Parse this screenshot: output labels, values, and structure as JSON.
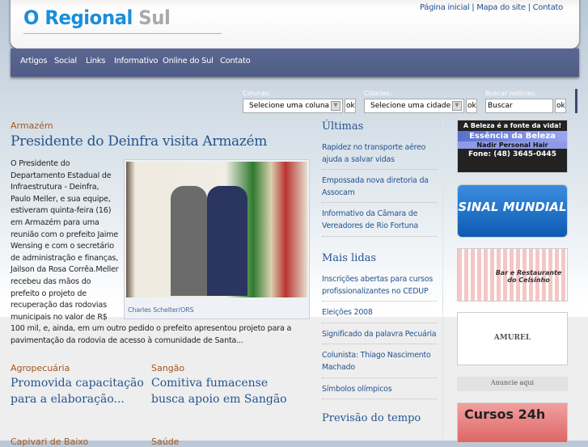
{
  "header": {
    "logo_main": "O Regional",
    "logo_accent": "Sul",
    "links": [
      "Página inicial",
      "Mapa do site",
      "Contato"
    ]
  },
  "nav": [
    "Artigos",
    "Social",
    "Links",
    "Informativo",
    "Online do Sul",
    "Contato"
  ],
  "filters": {
    "columns_label": "Colunas:",
    "columns_value": "Selecione uma coluna",
    "cities_label": "Cidades:",
    "cities_value": "Selecione uma cidade",
    "search_label": "Buscar notícias:",
    "search_value": "Buscar",
    "ok": "ok"
  },
  "main": {
    "category": "Armazém",
    "title": "Presidente do Deinfra visita Armazém",
    "body": "O Presidente do Departamento Estadual de Infraestrutura - Deinfra, Paulo Meller, e sua equipe, estiveram quinta-feira (16) em Armazém para uma reunião com o prefeito Jaime Wensing e com o secretário de administração e finanças, Jailson da Rosa Corrêa.Meller recebeu das mãos do prefeito o projeto de recuperação das rodovias municipais no valor de R$ 100 mil, e, ainda, em um outro pedido o prefeito apresentou projeto para a pavimentação da rodovia de acesso à comunidade de Santa...",
    "photo_credit": "Charles Schelter/ORS"
  },
  "stories": [
    {
      "category": "Agropecuária",
      "title": "Promovida capacitação para a elaboração..."
    },
    {
      "category": "Sangão",
      "title": "Comitiva fumacense busca apoio em Sangão"
    },
    {
      "category": "Capivari de Baixo",
      "title": ""
    },
    {
      "category": "Saúde",
      "title": ""
    }
  ],
  "sidebar": {
    "latest_title": "Últimas",
    "latest": [
      "Rapidez no transporte aéreo ajuda a salvar vidas",
      "Empossada nova diretoria da Assocam",
      "Informativo da Câmara de Vereadores de Rio Fortuna"
    ],
    "popular_title": "Mais lidas",
    "popular": [
      "Inscrições abertas para cursos profissionalizantes no CEDUP",
      "Eleições 2008",
      "Significado da palavra Pecuária",
      "Colunista: Thiago Nascimento Machado",
      "Símbolos olímpicos"
    ],
    "weather_title": "Previsão do tempo"
  },
  "ads": {
    "beleza": [
      "A Beleza é a fonte da vida!",
      "Essência da Beleza",
      "Nadir Personal Hair",
      "Fone: (48) 3645-0445"
    ],
    "sinal": "SINAL MUNDIAL",
    "bar": "Bar e Restaurante do Celsinho",
    "amurel": "AMUREL",
    "advertise": "Anuncie aqui",
    "cursos": "Cursos 24h"
  }
}
